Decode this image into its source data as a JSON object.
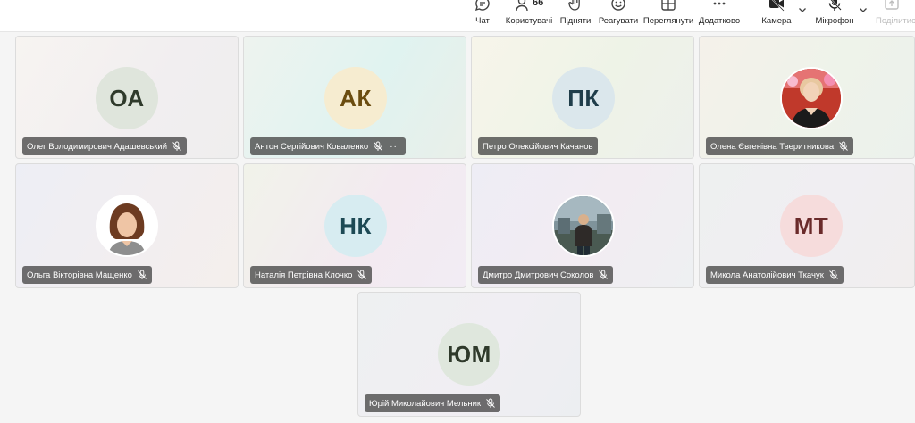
{
  "toolbar": {
    "chat": "Чат",
    "people_count": "66",
    "people": "Користувачі",
    "raise": "Підняти",
    "react": "Реагувати",
    "view": "Переглянути",
    "more": "Додатково",
    "camera": "Камера",
    "mic": "Мікрофон",
    "share": "Поділитися"
  },
  "participants": [
    {
      "name": "Олег Володимирович Адашевський",
      "initials": "ОА"
    },
    {
      "name": "Антон Сергійович Коваленко",
      "initials": "АК"
    },
    {
      "name": "Петро Олексійович Качанов",
      "initials": "ПК"
    },
    {
      "name": "Олена Євгенівна Тверитникова",
      "initials": ""
    },
    {
      "name": "Ольга Вікторівна Мащенко",
      "initials": ""
    },
    {
      "name": "Наталія Петрівна Клочко",
      "initials": "НК"
    },
    {
      "name": "Дмитро Дмитрович Соколов",
      "initials": ""
    },
    {
      "name": "Микола Анатолійович Ткачук",
      "initials": "МТ"
    },
    {
      "name": "Юрій Миколайович Мельник",
      "initials": "ЮМ"
    }
  ],
  "colors": {
    "avatar_oa": "#dfe5dc",
    "avatar_ak": "#f6ecd0",
    "avatar_pk": "#dbe7ec",
    "avatar_nk": "#d7ecf1",
    "avatar_mt": "#f6dcdc",
    "avatar_ym": "#dfe7dd",
    "nameplate": "#464646"
  }
}
